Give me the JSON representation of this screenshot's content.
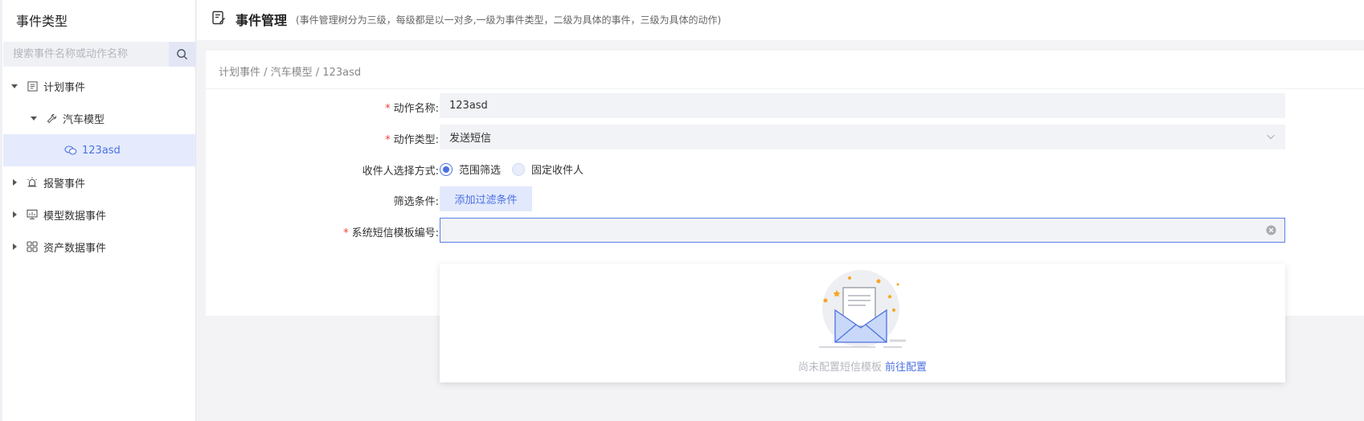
{
  "sidebar": {
    "title": "事件类型",
    "search_placeholder": "搜索事件名称或动作名称",
    "tree": [
      {
        "label": "计划事件",
        "icon": "document-list-icon",
        "expanded": true
      },
      {
        "label": "汽车模型",
        "icon": "wrench-icon",
        "expanded": true
      },
      {
        "label": "123asd",
        "icon": "message-bubbles-icon",
        "selected": true
      },
      {
        "label": "报警事件",
        "icon": "alarm-light-icon",
        "expanded": false
      },
      {
        "label": "模型数据事件",
        "icon": "monitor-chart-icon",
        "expanded": false
      },
      {
        "label": "资产数据事件",
        "icon": "grid-apps-icon",
        "expanded": false
      }
    ]
  },
  "header": {
    "title": "事件管理",
    "subtitle": "(事件管理树分为三级，每级都是以一对多,一级为事件类型，二级为具体的事件，三级为具体的动作)"
  },
  "breadcrumb": "计划事件 / 汽车模型 / 123asd",
  "form": {
    "action_name": {
      "label": "动作名称:",
      "value": "123asd"
    },
    "action_type": {
      "label": "动作类型:",
      "value": "发送短信"
    },
    "recipient_mode": {
      "label": "收件人选择方式:",
      "option_range": "范围筛选",
      "option_fixed": "固定收件人",
      "selected": "范围筛选"
    },
    "filter": {
      "label": "筛选条件:",
      "button": "添加过滤条件"
    },
    "template": {
      "label": "系统短信模板编号:",
      "value": ""
    }
  },
  "dropdown": {
    "empty_text": "尚未配置短信模板",
    "link_text": "前往配置"
  },
  "colors": {
    "accent": "#4b71e3",
    "required": "#f04134",
    "selected_bg": "#e5ebfd"
  }
}
